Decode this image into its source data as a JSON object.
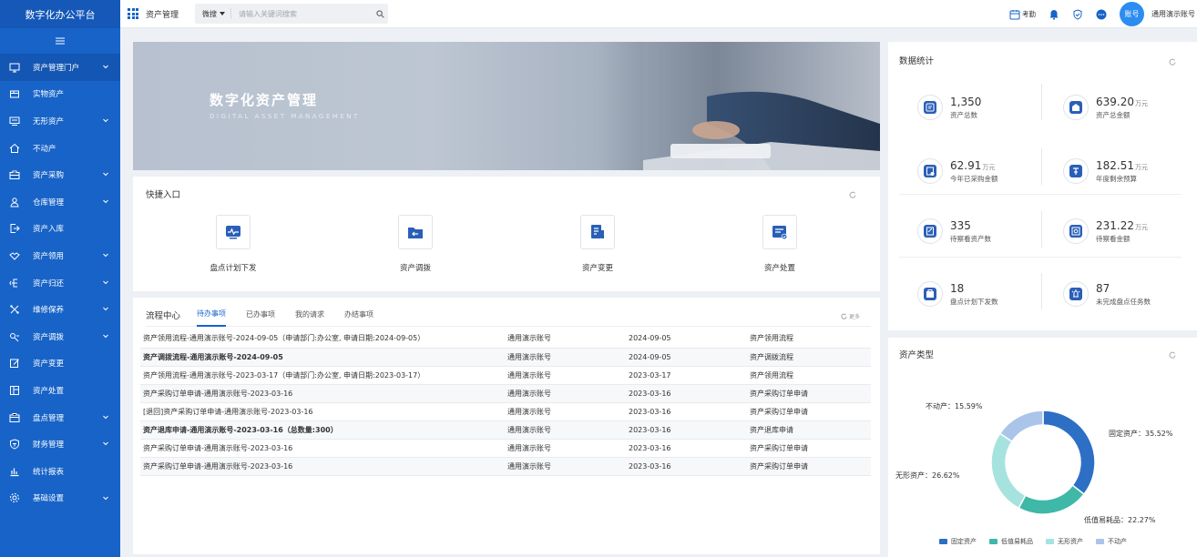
{
  "app": {
    "title": "数字化办公平台"
  },
  "sidebar": {
    "items": [
      {
        "label": "资产管理门户",
        "icon": "monitor-icon",
        "has_children": true,
        "active": true
      },
      {
        "label": "实物资产",
        "icon": "box-icon",
        "has_children": false
      },
      {
        "label": "无形资产",
        "icon": "display-icon",
        "has_children": true
      },
      {
        "label": "不动产",
        "icon": "home-icon",
        "has_children": false
      },
      {
        "label": "资产采购",
        "icon": "briefcase-icon",
        "has_children": true
      },
      {
        "label": "仓库管理",
        "icon": "warehouse-icon",
        "has_children": true
      },
      {
        "label": "资产入库",
        "icon": "import-icon",
        "has_children": false
      },
      {
        "label": "资产领用",
        "icon": "handshake-icon",
        "has_children": true
      },
      {
        "label": "资产归还",
        "icon": "return-icon",
        "has_children": true
      },
      {
        "label": "维修保养",
        "icon": "tools-icon",
        "has_children": true
      },
      {
        "label": "资产调拨",
        "icon": "transfer-icon",
        "has_children": true
      },
      {
        "label": "资产变更",
        "icon": "edit-icon",
        "has_children": false
      },
      {
        "label": "资产处置",
        "icon": "dispose-icon",
        "has_children": false
      },
      {
        "label": "盘点管理",
        "icon": "inventory-icon",
        "has_children": true
      },
      {
        "label": "财务管理",
        "icon": "shield-icon",
        "has_children": true
      },
      {
        "label": "统计报表",
        "icon": "chart-icon",
        "has_children": false
      },
      {
        "label": "基础设置",
        "icon": "settings-icon",
        "has_children": true
      }
    ]
  },
  "topbar": {
    "module_title": "资产管理",
    "search_scope": "微搜",
    "search_placeholder": "请输入关键词搜索",
    "attendance_label": "考勤",
    "avatar_text": "账号",
    "username": "通用演示账号"
  },
  "banner": {
    "title": "数字化资产管理",
    "subtitle": "DIGITAL ASSET MANAGEMENT"
  },
  "quick": {
    "title": "快捷入口",
    "items": [
      {
        "label": "盘点计划下发",
        "icon": "plan-dispatch-icon"
      },
      {
        "label": "资产调拨",
        "icon": "folder-transfer-icon"
      },
      {
        "label": "资产变更",
        "icon": "asset-change-icon"
      },
      {
        "label": "资产处置",
        "icon": "asset-dispose-icon"
      }
    ]
  },
  "flow": {
    "title": "流程中心",
    "tabs": [
      "待办事项",
      "已办事项",
      "我的请求",
      "办结事项"
    ],
    "active_tab": 0,
    "more": "更多",
    "rows": [
      {
        "title": "资产领用流程-通用演示账号-2024-09-05（申请部门:办公室, 申请日期:2024-09-05）",
        "user": "通用演示账号",
        "date": "2024-09-05",
        "type": "资产领用流程",
        "bold": false
      },
      {
        "title": "资产调拨流程-通用演示账号-2024-09-05",
        "user": "通用演示账号",
        "date": "2024-09-05",
        "type": "资产调拨流程",
        "bold": true
      },
      {
        "title": "资产领用流程-通用演示账号-2023-03-17（申请部门:办公室, 申请日期:2023-03-17）",
        "user": "通用演示账号",
        "date": "2023-03-17",
        "type": "资产领用流程",
        "bold": false
      },
      {
        "title": "资产采购订单申请-通用演示账号-2023-03-16",
        "user": "通用演示账号",
        "date": "2023-03-16",
        "type": "资产采购订单申请",
        "bold": false
      },
      {
        "title": "[退回]资产采购订单申请-通用演示账号-2023-03-16",
        "user": "通用演示账号",
        "date": "2023-03-16",
        "type": "资产采购订单申请",
        "bold": false
      },
      {
        "title": "资产退库申请-通用演示账号-2023-03-16（总数量:300）",
        "user": "通用演示账号",
        "date": "2023-03-16",
        "type": "资产退库申请",
        "bold": true
      },
      {
        "title": "资产采购订单申请-通用演示账号-2023-03-16",
        "user": "通用演示账号",
        "date": "2023-03-16",
        "type": "资产采购订单申请",
        "bold": false
      },
      {
        "title": "资产采购订单申请-通用演示账号-2023-03-16",
        "user": "通用演示账号",
        "date": "2023-03-16",
        "type": "资产采购订单申请",
        "bold": false
      }
    ]
  },
  "stats": {
    "title": "数据统计",
    "items": [
      {
        "value": "1,350",
        "unit": "",
        "label": "资产总数",
        "icon": "asset-count-icon"
      },
      {
        "value": "639.20",
        "unit": "万元",
        "label": "资产总金额",
        "icon": "asset-amount-icon"
      },
      {
        "value": "62.91",
        "unit": "万元",
        "label": "今年已采购金额",
        "icon": "purchase-amount-icon"
      },
      {
        "value": "182.51",
        "unit": "万元",
        "label": "年度剩余预算",
        "icon": "budget-icon"
      },
      {
        "value": "335",
        "unit": "",
        "label": "待察看资产数",
        "icon": "pending-assets-icon"
      },
      {
        "value": "231.22",
        "unit": "万元",
        "label": "待察看金额",
        "icon": "pending-amount-icon"
      },
      {
        "value": "18",
        "unit": "",
        "label": "盘点计划下发数",
        "icon": "inventory-plan-icon"
      },
      {
        "value": "87",
        "unit": "",
        "label": "未完成盘点任务数",
        "icon": "unfinished-task-icon"
      }
    ]
  },
  "asset_types": {
    "title": "资产类型",
    "chart_data": {
      "type": "pie",
      "donut": true,
      "categories": [
        "固定资产",
        "低值易耗品",
        "无形资产",
        "不动产"
      ],
      "values": [
        35.52,
        22.27,
        26.62,
        15.59
      ],
      "slice_labels": [
        "固定资产：35.52%",
        "低值易耗品：22.27%",
        "无形资产：26.62%",
        "不动产：15.59%"
      ],
      "colors": [
        "#2d6fc4",
        "#3fb8a8",
        "#a6e3df",
        "#aac4ea"
      ],
      "legend_position": "bottom"
    }
  }
}
